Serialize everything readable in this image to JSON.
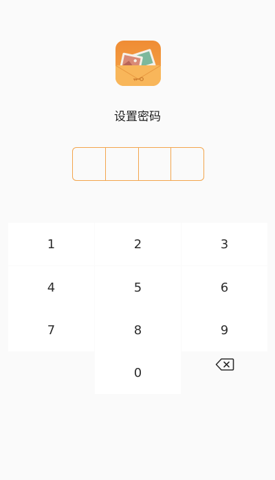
{
  "screen": {
    "title": "设置密码",
    "pin_length": 4,
    "entered_digits": 0
  },
  "keypad": {
    "keys": [
      "1",
      "2",
      "3",
      "4",
      "5",
      "6",
      "7",
      "8",
      "9",
      "0"
    ],
    "backspace_icon": "backspace-icon"
  },
  "colors": {
    "accent": "#f2a44a",
    "background": "#fafafa",
    "key_background": "#ffffff",
    "text": "#1e1e1e"
  },
  "app_icon": {
    "icon": "photo-vault-icon"
  }
}
